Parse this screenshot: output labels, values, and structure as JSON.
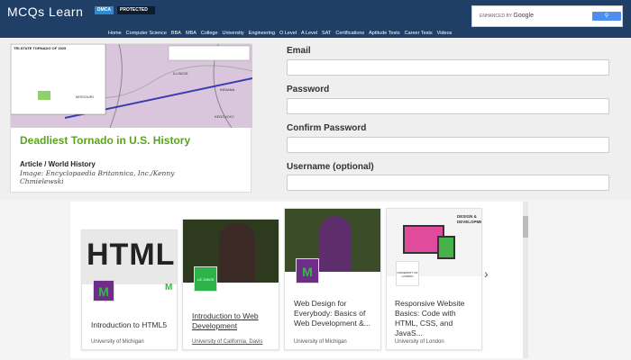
{
  "site": {
    "logo": "MCQs Learn",
    "dmca": "DMCA",
    "protected": "PROTECTED"
  },
  "search": {
    "prefix": "ENHANCED BY",
    "brand": "Google",
    "button_icon": "search-icon"
  },
  "nav": [
    "Home",
    "Computer Science",
    "BBA",
    "MBA",
    "College",
    "University",
    "Engineering",
    "O Level",
    "A Level",
    "SAT",
    "Certifications",
    "Aptitude Tests",
    "Career Tests",
    "Videos"
  ],
  "article": {
    "title": "Deadliest Tornado in U.S. History",
    "category": "Article / World History",
    "credit": "Image: Encyclopaedia Britannica, Inc./Kenny Chmielewski",
    "map_labels": [
      "TRI-STATE TORNADO OF 1925",
      "MISSOURI",
      "ILLINOIS",
      "INDIANA",
      "KENTUCKY"
    ]
  },
  "form": {
    "fields": [
      {
        "label": "Email",
        "value": ""
      },
      {
        "label": "Password",
        "value": ""
      },
      {
        "label": "Confirm Password",
        "value": ""
      },
      {
        "label": "Username (optional)",
        "value": ""
      }
    ]
  },
  "courses": [
    {
      "title": "Introduction to HTML5",
      "source": "University of Michigan",
      "image_text": "HTML",
      "logo_text": "M"
    },
    {
      "title": "Introduction to Web Development",
      "source": "University of California, Davis",
      "logo_text": "UC DAVIS"
    },
    {
      "title": "Web Design for Everybody: Basics of Web Development &...",
      "source": "University of Michigan",
      "logo_text": "M"
    },
    {
      "title": "Responsive Website Basics: Code with HTML, CSS, and JavaS...",
      "source": "University of London",
      "image_text": "DESIGN & DEVELOPMENT",
      "logo_text": "UNIVERSITY OF LONDON"
    }
  ],
  "carousel": {
    "next_icon": "chevron-right-icon"
  },
  "colors": {
    "topbar": "#1f3f66",
    "title_green": "#5ba31d",
    "michigan_green": "#39b54a",
    "michigan_purple": "#7b2d8e"
  }
}
